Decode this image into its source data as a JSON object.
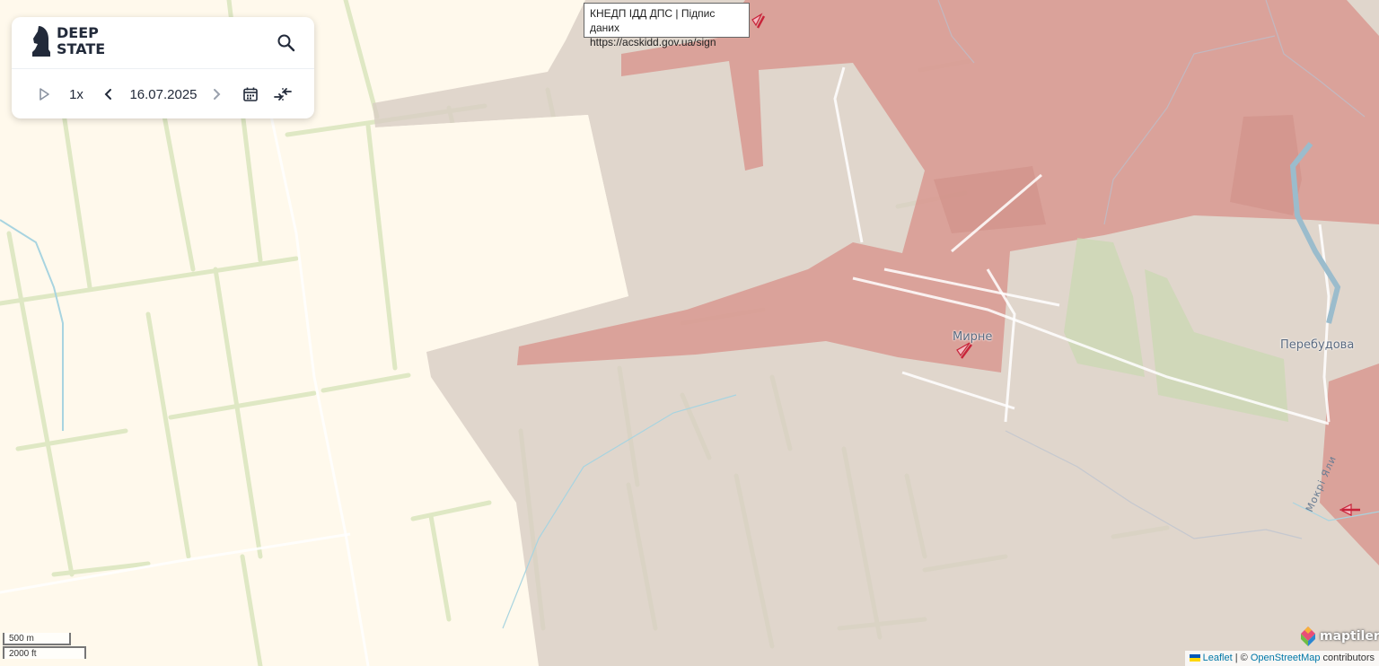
{
  "app": {
    "logo_line1": "DEEP",
    "logo_line2": "STATE"
  },
  "toolbar": {
    "speed": "1x",
    "date": "16.07.2025"
  },
  "tooltip": {
    "line1": "КНЕДП ІДД ДПС | Підпис даних",
    "line2": "https://acskidd.gov.ua/sign"
  },
  "places": {
    "myrne": "Мирне",
    "perebudova": "Перебудова",
    "river": "Мокрі Яли"
  },
  "scale": {
    "metric": "500 m",
    "imperial": "2000 ft"
  },
  "attribution": {
    "leaflet": "Leaflet",
    "sep": " | © ",
    "osm": "OpenStreetMap",
    "suffix": " contributors",
    "maptiler": "maptiler"
  },
  "colors": {
    "occupied": "#d9948c",
    "grey_zone": "#d8cdc4",
    "field_lines": "#dfe8c4",
    "background": "#fff9ec"
  },
  "icons": {
    "play": "play-icon",
    "prev": "chevron-left-icon",
    "next": "chevron-right-icon",
    "calendar": "calendar-icon",
    "compare": "compare-arrows-icon",
    "search": "search-icon",
    "direction": "red-arrow-icon"
  }
}
